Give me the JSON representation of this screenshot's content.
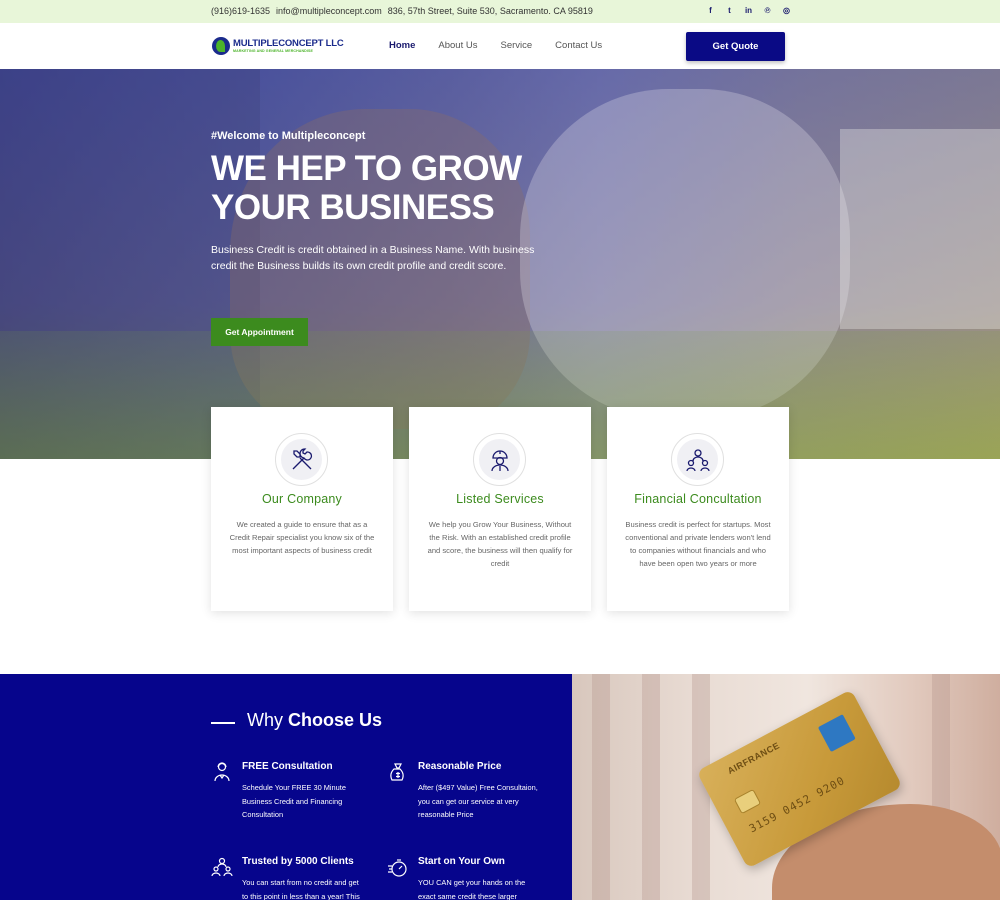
{
  "topbar": {
    "phone": "(916)619-1635",
    "email": "info@multipleconcept.com",
    "address": "836, 57th Street, Suite 530, Sacramento. CA 95819",
    "socials": [
      {
        "icon": "facebook-icon",
        "glyph": "f"
      },
      {
        "icon": "twitter-icon",
        "glyph": "t"
      },
      {
        "icon": "linkedin-icon",
        "glyph": "in"
      },
      {
        "icon": "pinterest-icon",
        "glyph": "℗"
      },
      {
        "icon": "instagram-icon",
        "glyph": "◎"
      }
    ]
  },
  "header": {
    "logo_name": "MULTIPLECONCEPT LLC",
    "logo_tagline": "MARKETING AND GENERAL MERCHANDISE",
    "nav": [
      "Home",
      "About Us",
      "Service",
      "Contact Us"
    ],
    "active_nav": "Home",
    "quote_label": "Get Quote"
  },
  "hero": {
    "kicker": "#Welcome to Multipleconcept",
    "title": "WE HEP TO GROW YOUR BUSINESS",
    "description": "Business Credit is credit obtained in a Business Name. With business credit the Business builds its own credit profile and credit score.",
    "button_label": "Get Appointment"
  },
  "cards": [
    {
      "icon": "tools-icon",
      "title": "Our Company",
      "text": "We created a guide to ensure that as a Credit Repair specialist you know six of the most important aspects of business credit"
    },
    {
      "icon": "worker-icon",
      "title": "Listed Services",
      "text": "We help you Grow Your Business, Without the Risk. With an established credit profile and score, the business will then qualify for credit"
    },
    {
      "icon": "team-icon",
      "title": "Financial Concultation",
      "text": "Business credit is perfect for startups. Most conventional and private lenders won't lend to companies without financials and who have been open two years or more"
    }
  ],
  "why": {
    "title_light": "Why",
    "title_bold": "Choose Us",
    "features": [
      {
        "icon": "consultant-icon",
        "title": "FREE Consultation",
        "text": "Schedule Your FREE 30 Minute Business Credit and Financing Consultation"
      },
      {
        "icon": "money-bag-icon",
        "title": "Reasonable Price",
        "text": "After ($497 Value) Free Consultaion, you can get our service at very reasonable Price"
      },
      {
        "icon": "clients-icon",
        "title": "Trusted by 5000 Clients",
        "text": "You can start from no credit and get to this point in less than a year! This"
      },
      {
        "icon": "stopwatch-icon",
        "title": "Start on Your Own",
        "text": "YOU CAN get your hands on the exact same credit these larger companies"
      }
    ]
  },
  "photo": {
    "card_brand": "AIRFRANCE",
    "card_number": "3159 0452 9200"
  },
  "colors": {
    "brand_navy": "#0a0a85",
    "brand_green": "#3c8b1e",
    "topbar_bg": "#e8f6d9"
  }
}
